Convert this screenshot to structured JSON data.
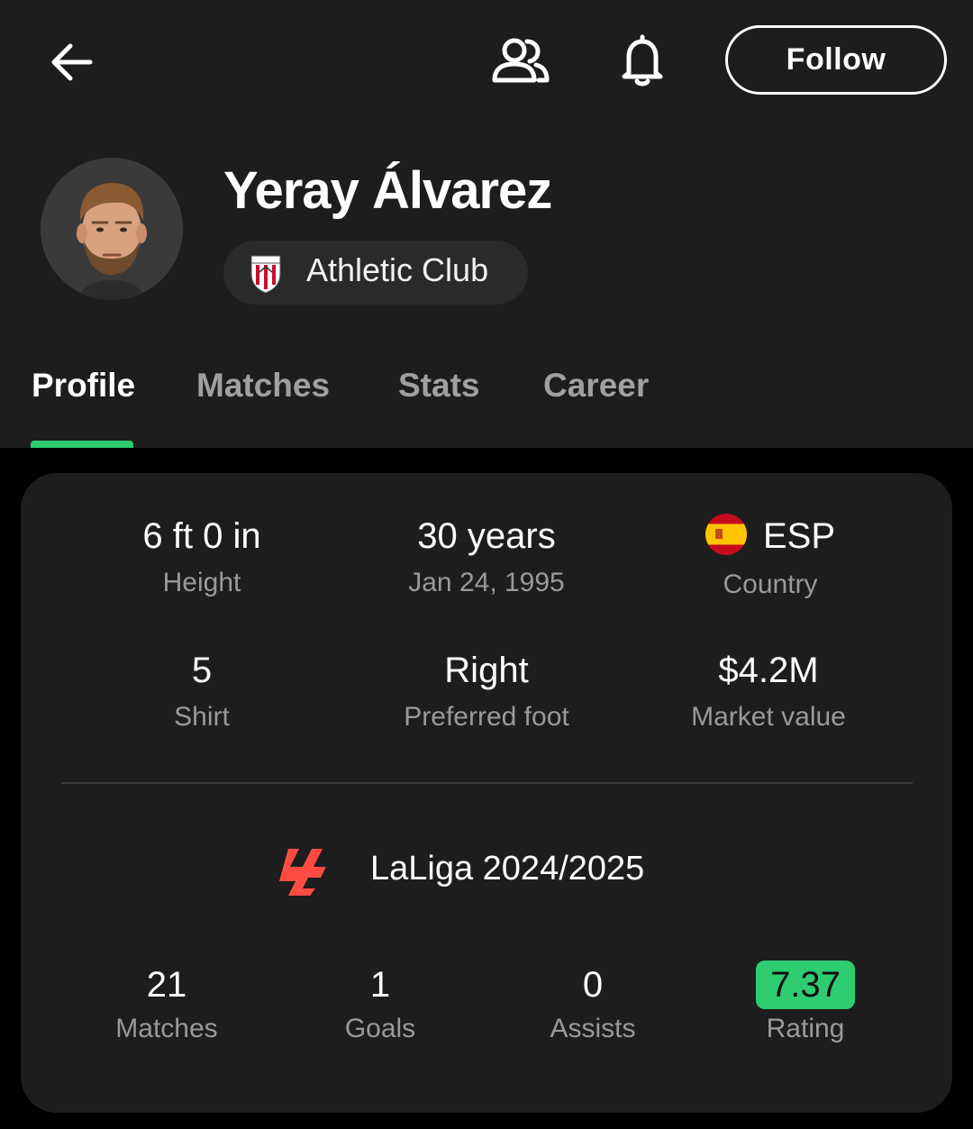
{
  "header": {
    "follow_label": "Follow"
  },
  "player": {
    "name": "Yeray Álvarez",
    "club": "Athletic Club"
  },
  "tabs": [
    {
      "label": "Profile",
      "active": true
    },
    {
      "label": "Matches",
      "active": false
    },
    {
      "label": "Stats",
      "active": false
    },
    {
      "label": "Career",
      "active": false
    }
  ],
  "info": {
    "height": {
      "value": "6 ft 0 in",
      "label": "Height"
    },
    "age": {
      "value": "30 years",
      "label": "Jan 24, 1995"
    },
    "country": {
      "value": "ESP",
      "label": "Country"
    },
    "shirt": {
      "value": "5",
      "label": "Shirt"
    },
    "foot": {
      "value": "Right",
      "label": "Preferred foot"
    },
    "market": {
      "value": "$4.2M",
      "label": "Market value"
    }
  },
  "season": {
    "league": "LaLiga 2024/2025",
    "stats": [
      {
        "value": "21",
        "label": "Matches"
      },
      {
        "value": "1",
        "label": "Goals"
      },
      {
        "value": "0",
        "label": "Assists"
      },
      {
        "value": "7.37",
        "label": "Rating"
      }
    ]
  },
  "colors": {
    "accent": "#2ecc71",
    "rating_badge": "#2ecc71",
    "background": "#1d1d1d"
  }
}
